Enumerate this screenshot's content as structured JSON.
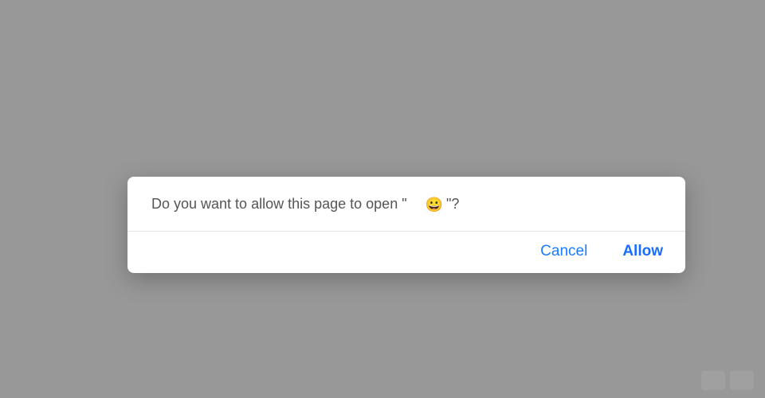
{
  "dialog": {
    "message_prefix": "Do you want to allow this page to open \"",
    "app_name": "😀",
    "message_suffix": "\"?",
    "cancel_label": "Cancel",
    "allow_label": "Allow"
  }
}
